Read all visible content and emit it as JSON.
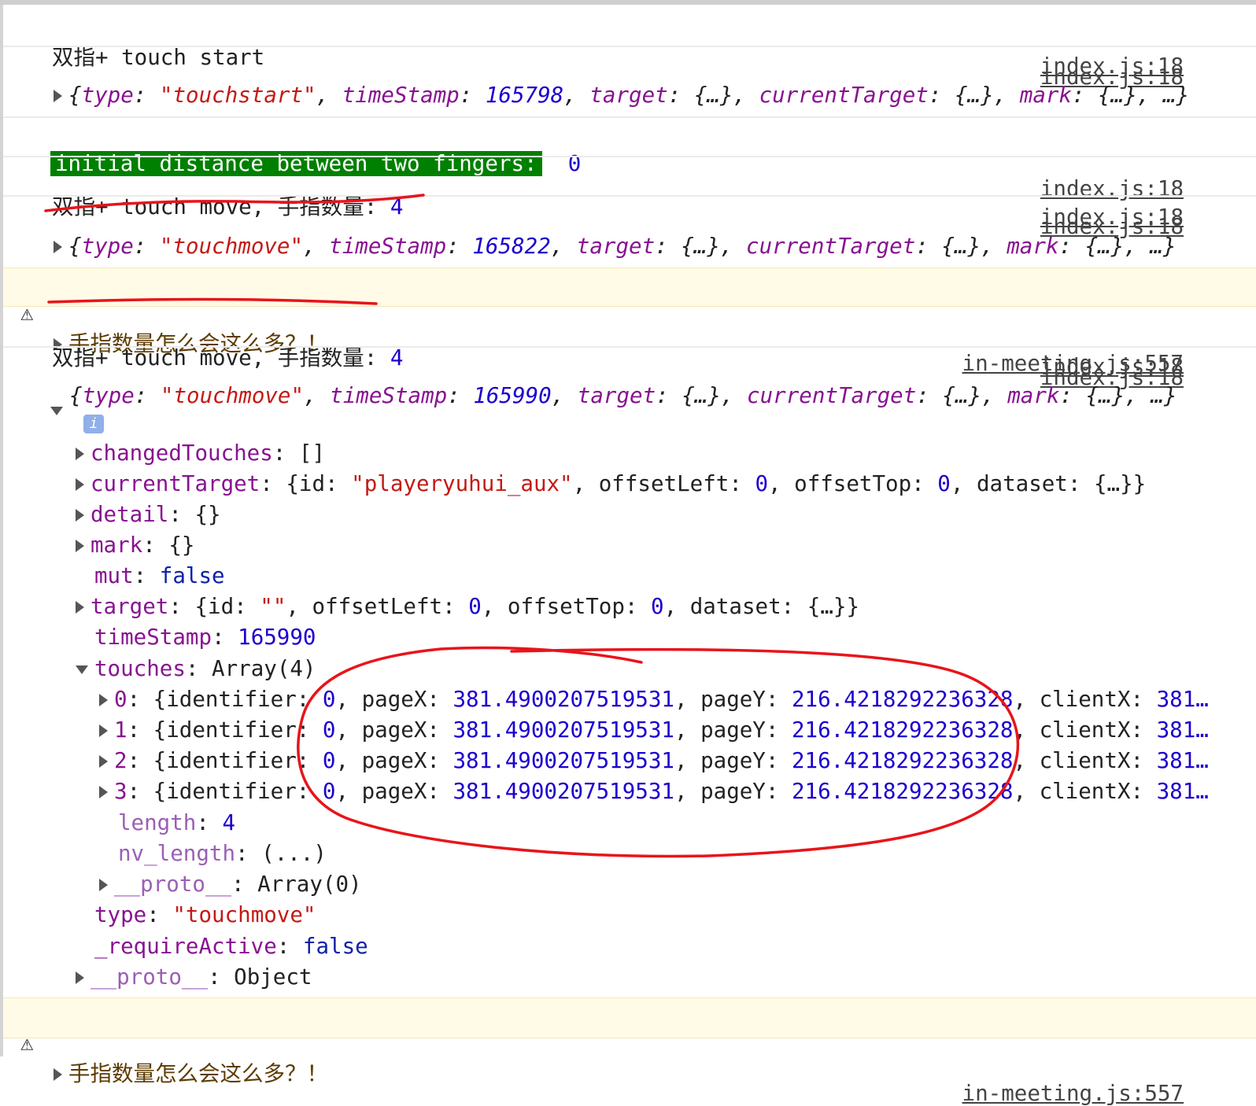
{
  "logs": [
    {
      "text": "双指+ touch start",
      "source": "index.js:18"
    },
    {
      "source": "index.js:18",
      "obj": {
        "open": "{",
        "type_key": "type",
        "type_val": "\"touchstart\"",
        "ts_key": "timeStamp",
        "ts_val": "165798",
        "target_key": "target",
        "ellipsis_obj": "{…}",
        "ct_key": "currentTarget",
        "mark_key": "mark",
        "tail": "…}"
      }
    },
    {
      "label": "initial distance between two fingers:",
      "value": "0",
      "label_bg": "#008000",
      "source": "index.js:18"
    },
    {
      "text": "双指+ touch move, 手指数量: ",
      "count": "4",
      "source": "index.js:18"
    },
    {
      "source": "index.js:18",
      "obj": {
        "type_val": "\"touchmove\"",
        "ts_val": "165822"
      }
    },
    {
      "level": "warning",
      "text": "手指数量怎么会这么多？！",
      "source": "in-meeting.js:557"
    },
    {
      "text": "双指+ touch move, 手指数量: ",
      "count": "4",
      "source": "index.js:18"
    },
    {
      "source": "index.js:18",
      "obj": {
        "type_val": "\"touchmove\"",
        "ts_val": "165990"
      }
    },
    {
      "level": "warning",
      "text": "手指数量怎么会这么多？！",
      "source": "in-meeting.js:557"
    }
  ],
  "expanded": {
    "info_badge": "i",
    "changedTouches": {
      "key": "changedTouches",
      "val": "[]"
    },
    "currentTarget": {
      "key": "currentTarget",
      "id_key": "id",
      "id_val": "\"playeryuhui_aux\"",
      "ol_key": "offsetLeft",
      "ol_val": "0",
      "ot_key": "offsetTop",
      "ot_val": "0",
      "ds_key": "dataset",
      "ds_val": "{…}"
    },
    "detail": {
      "key": "detail",
      "val": "{}"
    },
    "mark": {
      "key": "mark",
      "val": "{}"
    },
    "mut": {
      "key": "mut",
      "val": "false"
    },
    "target": {
      "key": "target",
      "id_val": "\"\""
    },
    "timeStamp": {
      "key": "timeStamp",
      "val": "165990"
    },
    "touches": {
      "key": "touches",
      "val": "Array(4)"
    },
    "touch_items": [
      {
        "idx": "0",
        "identifier": "0",
        "pageX": "381.4900207519531",
        "pageY": "216.4218292236328",
        "clientX": "381…"
      },
      {
        "idx": "1",
        "identifier": "0",
        "pageX": "381.4900207519531",
        "pageY": "216.4218292236328",
        "clientX": "381…"
      },
      {
        "idx": "2",
        "identifier": "0",
        "pageX": "381.4900207519531",
        "pageY": "216.4218292236328",
        "clientX": "381…"
      },
      {
        "idx": "3",
        "identifier": "0",
        "pageX": "381.4900207519531",
        "pageY": "216.4218292236328",
        "clientX": "381…"
      }
    ],
    "length": {
      "key": "length",
      "val": "4"
    },
    "nv_length": {
      "key": "nv_length",
      "val": "(...)"
    },
    "touches_proto": {
      "key": "__proto__",
      "val": "Array(0)"
    },
    "type": {
      "key": "type",
      "val": "\"touchmove\""
    },
    "requireActive": {
      "key": "_requireActive",
      "val": "false"
    },
    "obj_proto": {
      "key": "__proto__",
      "val": "Object"
    }
  },
  "colors": {
    "annotation": "#e8141b",
    "warning_bg": "#fffbe6",
    "key": "#881391",
    "string": "#c41a16",
    "number": "#1c00cf"
  }
}
